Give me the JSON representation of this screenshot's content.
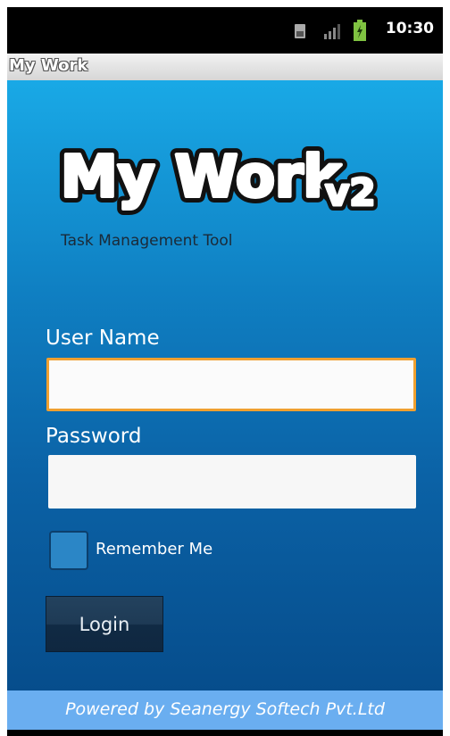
{
  "status_bar": {
    "time": "10:30",
    "icons": [
      "sim-icon",
      "signal-icon",
      "battery-icon"
    ]
  },
  "app": {
    "title": "My Work"
  },
  "logo": {
    "text": "My Work v2",
    "subtitle": "Task Management Tool"
  },
  "form": {
    "username_label": "User Name",
    "username_value": "",
    "password_label": "Password",
    "password_value": "",
    "remember_label": "Remember Me",
    "remember_checked": false,
    "login_label": "Login"
  },
  "footer": {
    "text": "Powered by Seanergy Softech Pvt.Ltd"
  },
  "colors": {
    "accent_focus": "#f0a030",
    "background_top": "#19a9e6",
    "background_bottom": "#064d8c",
    "footer": "#6aaef0",
    "button": "#1e3a55"
  }
}
